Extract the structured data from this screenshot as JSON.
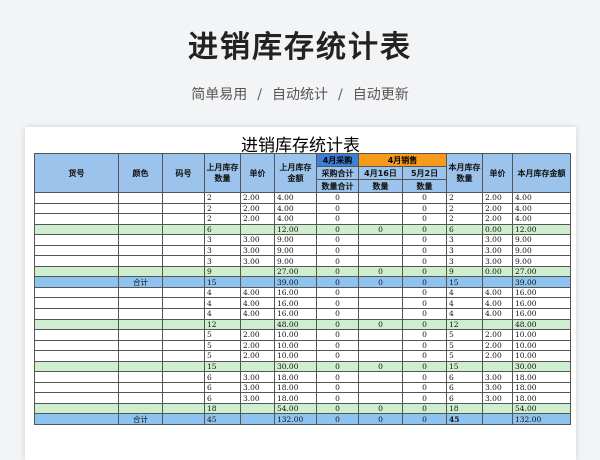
{
  "page": {
    "title": "进销库存统计表",
    "subtitle_items": [
      "简单易用",
      "自动统计",
      "自动更新"
    ],
    "subtitle_sep": "/"
  },
  "sheet": {
    "title": "进销库存统计表",
    "headers": {
      "goods_no": "货号",
      "color": "颜色",
      "size": "码号",
      "last_stock_qty": "上月库存数量",
      "unit_price": "单价",
      "last_stock_amount": "上月库存金额",
      "purchase_group": "4月采购",
      "sales_group": "4月销售",
      "purchase_total": "采购合计",
      "sale_apr16": "4月16日",
      "sale_may2": "5月2日",
      "qty_label": "数量合计",
      "qty": "数量",
      "qty2": "数量",
      "this_stock_qty": "本月库存数量",
      "unit_price2": "单价",
      "this_stock_amount": "本月库存金额"
    },
    "rows": [
      {
        "type": "item",
        "c": [
          "",
          "",
          "",
          "2",
          "2.00",
          "4.00",
          "0",
          "",
          "0",
          "2",
          "2.00",
          "4.00"
        ]
      },
      {
        "type": "item",
        "c": [
          "",
          "",
          "",
          "2",
          "2.00",
          "4.00",
          "0",
          "",
          "0",
          "2",
          "2.00",
          "4.00"
        ]
      },
      {
        "type": "item",
        "c": [
          "",
          "",
          "",
          "2",
          "2.00",
          "4.00",
          "0",
          "",
          "0",
          "2",
          "2.00",
          "4.00"
        ]
      },
      {
        "type": "sub",
        "c": [
          "",
          "",
          "",
          "6",
          "",
          "12.00",
          "0",
          "0",
          "0",
          "6",
          "0.00",
          "12.00"
        ]
      },
      {
        "type": "item",
        "c": [
          "",
          "",
          "",
          "3",
          "3.00",
          "9.00",
          "0",
          "",
          "0",
          "3",
          "3.00",
          "9.00"
        ]
      },
      {
        "type": "item",
        "c": [
          "",
          "",
          "",
          "3",
          "3.00",
          "9.00",
          "0",
          "",
          "0",
          "3",
          "3.00",
          "9.00"
        ]
      },
      {
        "type": "item",
        "c": [
          "",
          "",
          "",
          "3",
          "3.00",
          "9.00",
          "0",
          "",
          "0",
          "3",
          "3.00",
          "9.00"
        ]
      },
      {
        "type": "sub",
        "c": [
          "",
          "",
          "",
          "9",
          "",
          "27.00",
          "0",
          "0",
          "0",
          "9",
          "0.00",
          "27.00"
        ]
      },
      {
        "type": "total",
        "c": [
          "",
          "合计",
          "",
          "15",
          "",
          "39.00",
          "0",
          "0",
          "0",
          "15",
          "",
          "39.00"
        ]
      },
      {
        "type": "item",
        "c": [
          "",
          "",
          "",
          "4",
          "4.00",
          "16.00",
          "0",
          "",
          "0",
          "4",
          "4.00",
          "16.00"
        ]
      },
      {
        "type": "item",
        "c": [
          "",
          "",
          "",
          "4",
          "4.00",
          "16.00",
          "0",
          "",
          "0",
          "4",
          "4.00",
          "16.00"
        ]
      },
      {
        "type": "item",
        "c": [
          "",
          "",
          "",
          "4",
          "4.00",
          "16.00",
          "0",
          "",
          "0",
          "4",
          "4.00",
          "16.00"
        ]
      },
      {
        "type": "sub",
        "c": [
          "",
          "",
          "",
          "12",
          "",
          "48.00",
          "0",
          "0",
          "0",
          "12",
          "",
          "48.00"
        ]
      },
      {
        "type": "item",
        "c": [
          "",
          "",
          "",
          "5",
          "2.00",
          "10.00",
          "0",
          "",
          "0",
          "5",
          "2.00",
          "10.00"
        ]
      },
      {
        "type": "item",
        "c": [
          "",
          "",
          "",
          "5",
          "2.00",
          "10.00",
          "0",
          "",
          "0",
          "5",
          "2.00",
          "10.00"
        ]
      },
      {
        "type": "item",
        "c": [
          "",
          "",
          "",
          "5",
          "2.00",
          "10.00",
          "0",
          "",
          "0",
          "5",
          "2.00",
          "10.00"
        ]
      },
      {
        "type": "sub",
        "c": [
          "",
          "",
          "",
          "15",
          "",
          "30.00",
          "0",
          "0",
          "0",
          "15",
          "",
          "30.00"
        ]
      },
      {
        "type": "item",
        "c": [
          "",
          "",
          "",
          "6",
          "3.00",
          "18.00",
          "0",
          "",
          "0",
          "6",
          "3.00",
          "18.00"
        ]
      },
      {
        "type": "item",
        "c": [
          "",
          "",
          "",
          "6",
          "3.00",
          "18.00",
          "0",
          "",
          "0",
          "6",
          "3.00",
          "18.00"
        ]
      },
      {
        "type": "item",
        "c": [
          "",
          "",
          "",
          "6",
          "3.00",
          "18.00",
          "0",
          "",
          "0",
          "6",
          "3.00",
          "18.00"
        ]
      },
      {
        "type": "sub",
        "c": [
          "",
          "",
          "",
          "18",
          "",
          "54.00",
          "0",
          "0",
          "0",
          "18",
          "",
          "54.00"
        ]
      },
      {
        "type": "total",
        "c": [
          "",
          "合计",
          "",
          "45",
          "",
          "132.00",
          "0",
          "0",
          "0",
          "45",
          "",
          "132.00"
        ]
      }
    ]
  }
}
